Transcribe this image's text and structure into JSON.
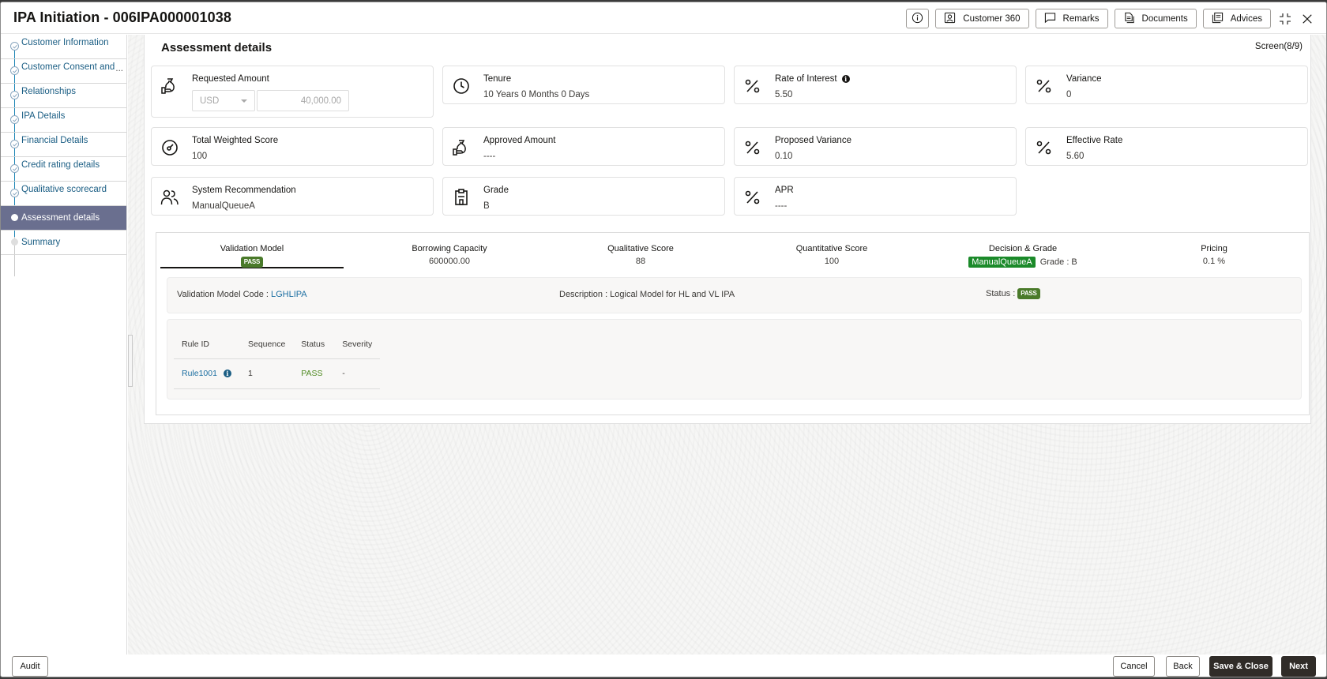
{
  "window": {
    "title": "IPA Initiation - 006IPA000001038",
    "header_buttons": [
      {
        "name": "info",
        "icon": "info-icon",
        "label": ""
      },
      {
        "name": "customer-360",
        "icon": "person-card-icon",
        "label": "Customer 360"
      },
      {
        "name": "remarks",
        "icon": "speech-bubble-icon",
        "label": "Remarks"
      },
      {
        "name": "documents",
        "icon": "documents-icon",
        "label": "Documents"
      },
      {
        "name": "advices",
        "icon": "advices-icon",
        "label": "Advices"
      }
    ],
    "minimize_icon": "collapse-icon",
    "close_icon": "close-icon"
  },
  "sidebar": {
    "items": [
      {
        "label": "Customer Information",
        "state": "done"
      },
      {
        "label": "Customer Consent and",
        "state": "done",
        "truncated": "..."
      },
      {
        "label": "Relationships",
        "state": "done"
      },
      {
        "label": "IPA Details",
        "state": "done"
      },
      {
        "label": "Financial Details",
        "state": "done"
      },
      {
        "label": "Credit rating details",
        "state": "done"
      },
      {
        "label": "Qualitative scorecard",
        "state": "done"
      },
      {
        "label": "Assessment details",
        "state": "active"
      },
      {
        "label": "Summary",
        "state": "todo"
      }
    ]
  },
  "main": {
    "page_title": "Assessment details",
    "screen_indicator": "Screen(8/9)",
    "tiles": {
      "requested_amount": {
        "label": "Requested Amount",
        "currency": "USD",
        "amount": "40,000.00",
        "icon": "money-bag-hand-icon"
      },
      "tenure": {
        "label": "Tenure",
        "value": "10 Years 0 Months 0 Days",
        "icon": "clock-icon"
      },
      "rate_of_interest": {
        "label": "Rate of Interest",
        "value": "5.50",
        "icon": "percent-icon"
      },
      "variance": {
        "label": "Variance",
        "value": "0",
        "icon": "percent-icon"
      },
      "total_weighted_score": {
        "label": "Total Weighted Score",
        "value": "100",
        "icon": "gauge-icon"
      },
      "approved_amount": {
        "label": "Approved Amount",
        "value": "----",
        "icon": "money-bag-hand-icon"
      },
      "proposed_variance": {
        "label": "Proposed Variance",
        "value": "0.10",
        "icon": "percent-icon"
      },
      "effective_rate": {
        "label": "Effective Rate",
        "value": "5.60",
        "icon": "percent-icon"
      },
      "system_recommendation": {
        "label": "System Recommendation",
        "value": "ManualQueueA",
        "icon": "users-icon"
      },
      "grade": {
        "label": "Grade",
        "value": "B",
        "icon": "clipboard-icon"
      },
      "apr": {
        "label": "APR",
        "value": "----",
        "icon": "percent-icon"
      }
    },
    "assessment_tabs": [
      {
        "label": "Validation Model",
        "value": "PASS",
        "active": true
      },
      {
        "label": "Borrowing Capacity",
        "value": "600000.00"
      },
      {
        "label": "Qualitative Score",
        "value": "88"
      },
      {
        "label": "Quantitative Score",
        "value": "100"
      },
      {
        "label": "Decision & Grade",
        "decision": "ManualQueueA",
        "grade_text": "Grade : B"
      },
      {
        "label": "Pricing",
        "value": "0.1 %"
      }
    ],
    "validation_model": {
      "code_label": "Validation Model Code :",
      "code_value": "LGHLIPA",
      "description_label": "Description :",
      "description_value": "Logical Model for HL and VL IPA",
      "status_label": "Status :",
      "status_value": "PASS"
    },
    "rules_table": {
      "headers": [
        "Rule ID",
        "Sequence",
        "Status",
        "Severity"
      ],
      "rows": [
        {
          "rule_id": "Rule1001",
          "sequence": "1",
          "status": "PASS",
          "severity": "-"
        }
      ]
    }
  },
  "footer": {
    "audit": "Audit",
    "cancel": "Cancel",
    "back": "Back",
    "save_close": "Save & Close",
    "next": "Next"
  },
  "colors": {
    "active_nav_bg": "#6a6f8f",
    "pass_badge": "#4a7a2a",
    "decision_badge": "#1b8a2a",
    "link": "#1b6ea1",
    "primary_button": "#302c28"
  }
}
